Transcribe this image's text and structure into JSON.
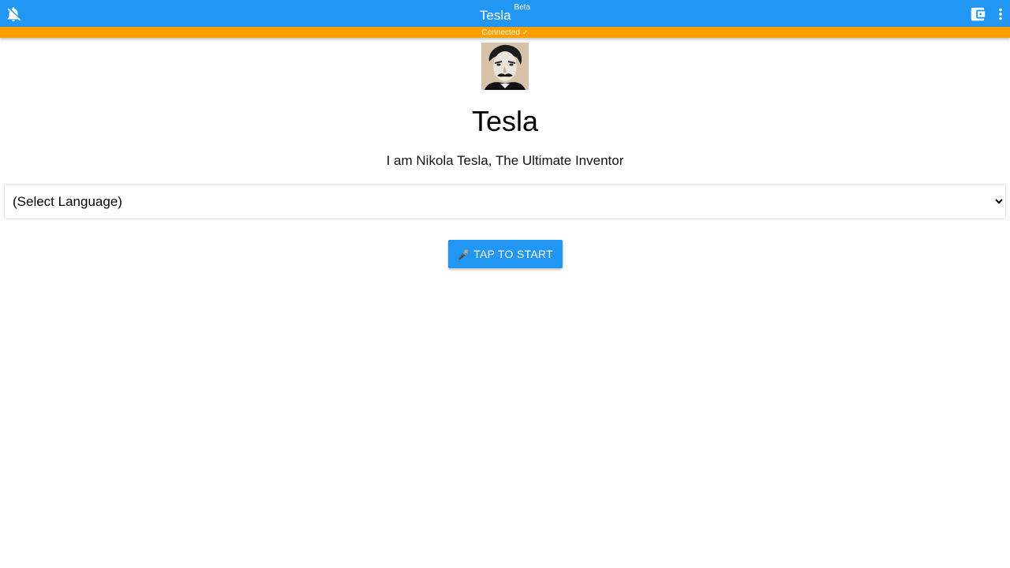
{
  "appbar": {
    "title": "Tesla",
    "badge": "Beta",
    "color": "#2196f3",
    "left_icon": "notifications-off-icon",
    "right_icons": [
      "wallet-icon",
      "more-vert-icon"
    ]
  },
  "status": {
    "text": "Connected",
    "icon": "check-icon",
    "color": "#ffa000"
  },
  "profile": {
    "avatar": "avatar-portrait",
    "name": "Tesla",
    "tagline": "I am Nikola Tesla, The Ultimate Inventor"
  },
  "language": {
    "selected": "(Select Language)"
  },
  "start_button": {
    "icon": "microphone-icon",
    "label": "TAP TO START",
    "color": "#2196f3"
  }
}
